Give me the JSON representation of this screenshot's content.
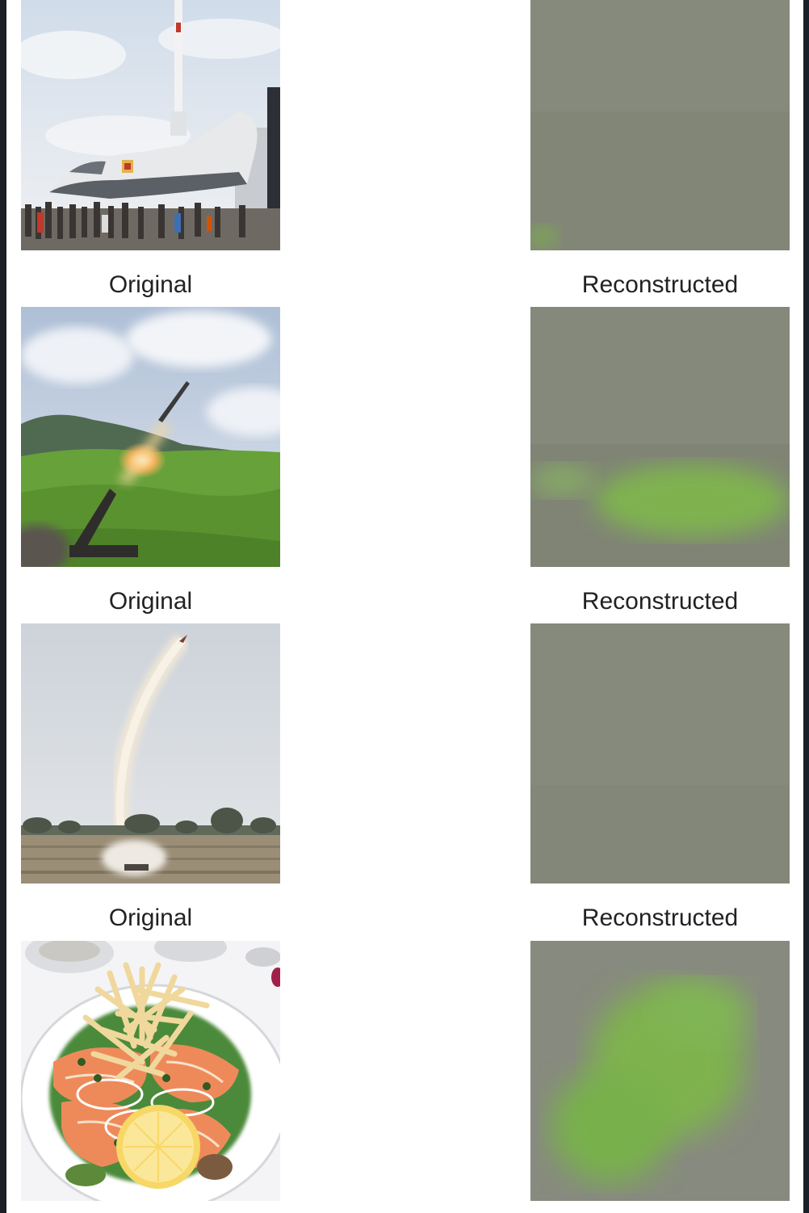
{
  "rows": [
    {
      "original_label": "",
      "reconstructed_label": ""
    },
    {
      "original_label": "Original",
      "reconstructed_label": "Reconstructed"
    },
    {
      "original_label": "Original",
      "reconstructed_label": "Reconstructed"
    },
    {
      "original_label": "Original",
      "reconstructed_label": "Reconstructed"
    }
  ],
  "colors": {
    "window_background": "#1b1f27",
    "panel_background": "#ffffff",
    "reconstruction_gray": "#848879",
    "reconstruction_green": "#76b84a"
  }
}
